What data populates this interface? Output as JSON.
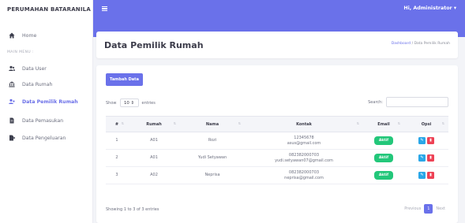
{
  "brand": "PERUMAHAN BATARANILA",
  "sidebar": {
    "home": "Home",
    "section_label": "MAIN MENU :",
    "items": [
      {
        "label": "Data User",
        "icon": "users-icon"
      },
      {
        "label": "Data Rumah",
        "icon": "bank-icon"
      },
      {
        "label": "Data Pemilik Rumah",
        "icon": "user-plus-icon",
        "active": true
      },
      {
        "label": "Data Pemasukan",
        "icon": "file-icon"
      },
      {
        "label": "Data Pengeluaran",
        "icon": "file-export-icon"
      }
    ]
  },
  "topbar": {
    "user": "Hi, Administrator ▾"
  },
  "header": {
    "title": "Data Pemilik Rumah",
    "breadcrumb_link": "Dashboard",
    "breadcrumb_sep": "/",
    "breadcrumb_current": "Data Pemilik Rumah"
  },
  "toolbar": {
    "add_label": "Tambah Data",
    "show_label": "Show",
    "entries_value": "10 ⇕",
    "entries_label": "entries",
    "search_label": "Search:",
    "search_value": ""
  },
  "table": {
    "headers": [
      "#",
      "Rumah",
      "Nama",
      "Kontak",
      "Email",
      "Opsi"
    ],
    "rows": [
      {
        "no": "1",
        "rumah": "A01",
        "nama": "Rozi",
        "phone": "12345678",
        "email": "asus@gmail.com",
        "status": "Aktif"
      },
      {
        "no": "2",
        "rumah": "A01",
        "nama": "Yudi Setyawan",
        "phone": "082382000703",
        "email": "yudi.setyawan07@gmail.com",
        "status": "Aktif"
      },
      {
        "no": "3",
        "rumah": "A02",
        "nama": "Neprisa",
        "phone": "082382000703",
        "email": "neprisa@gmail.com",
        "status": "Aktif"
      }
    ]
  },
  "footer": {
    "info": "Showing 1 to 3 of 3 entries",
    "previous": "Previous",
    "page": "1",
    "next": "Next"
  },
  "colors": {
    "accent": "#6a71ea",
    "active_badge": "#23c77a",
    "edit": "#2aa7e8",
    "delete": "#ee4255"
  }
}
